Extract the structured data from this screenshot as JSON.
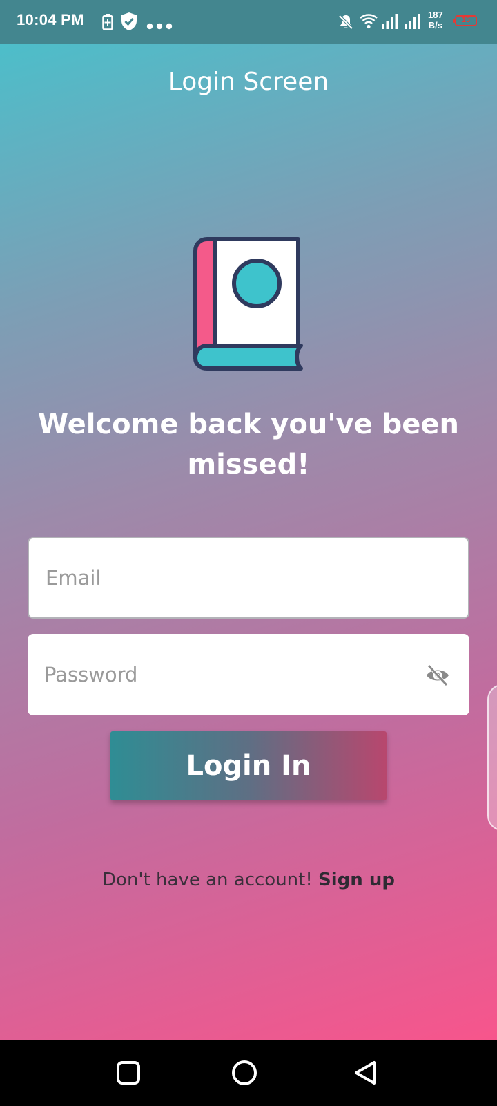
{
  "status_bar": {
    "time": "10:04 PM",
    "net_speed_value": "187",
    "net_speed_unit": "B/s",
    "battery_level": "15",
    "icons": [
      "battery-saver-icon",
      "shield-icon",
      "more-dots-icon",
      "notifications-off-icon",
      "wifi-icon",
      "signal-icon",
      "signal-icon-2",
      "battery-icon"
    ]
  },
  "app": {
    "title": "Login Screen",
    "logo_icon": "book-icon",
    "welcome_line1": "Welcome back you've been",
    "welcome_line2": "missed!"
  },
  "form": {
    "email_placeholder": "Email",
    "email_value": "",
    "password_placeholder": "Password",
    "password_value": "",
    "password_toggle_icon": "eye-off-icon",
    "login_label": "Login In"
  },
  "signup": {
    "prompt": "Don't have an account!",
    "link_label": "Sign up"
  },
  "colors": {
    "gradient_top": "#45c3cd",
    "gradient_bottom": "#f7558c",
    "status_bar": "#43868f",
    "book_spine": "#f45a8a",
    "book_accent": "#3ec3cc",
    "book_outline": "#2f3a5e",
    "battery_low": "#e53935"
  },
  "nav_bar": {
    "buttons": [
      "recents-square-icon",
      "home-circle-icon",
      "back-triangle-icon"
    ]
  }
}
